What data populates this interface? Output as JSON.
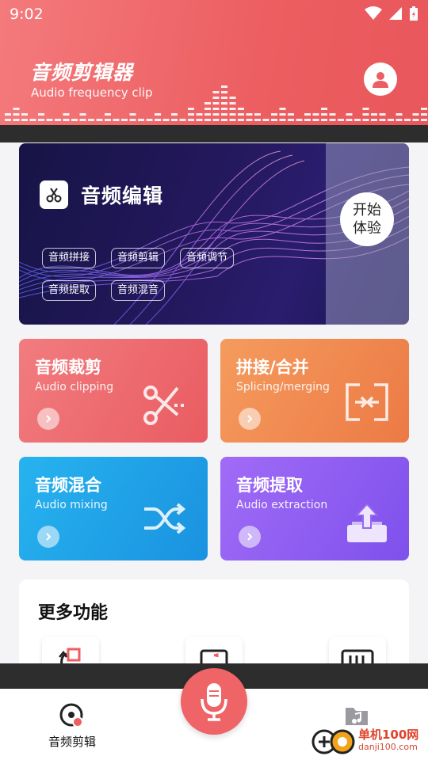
{
  "status_bar": {
    "time": "9:02"
  },
  "header": {
    "title": "音频剪辑器",
    "subtitle": "Audio frequency clip"
  },
  "banner": {
    "title": "音频编辑",
    "chips": [
      "音频拼接",
      "音频剪辑",
      "音频调节",
      "音频提取",
      "音频混音"
    ],
    "start_label_line1": "开始",
    "start_label_line2": "体验"
  },
  "cards": [
    {
      "title": "音频裁剪",
      "subtitle": "Audio clipping",
      "icon": "scissors-icon",
      "color": "#ee6b6e"
    },
    {
      "title": "拼接/合并",
      "subtitle": "Splicing/merging",
      "icon": "merge-icon",
      "color": "#f0894f"
    },
    {
      "title": "音频混合",
      "subtitle": "Audio mixing",
      "icon": "shuffle-icon",
      "color": "#1fa2e6"
    },
    {
      "title": "音频提取",
      "subtitle": "Audio extraction",
      "icon": "export-icon",
      "color": "#8a5cf0"
    }
  ],
  "more": {
    "title": "更多功能"
  },
  "nav": {
    "tab1_label": "音频剪辑"
  },
  "watermark": {
    "text": "单机100网",
    "url": "danji100.com"
  },
  "colors": {
    "accent": "#ec5e61",
    "banner_bg": "#1d175a"
  }
}
